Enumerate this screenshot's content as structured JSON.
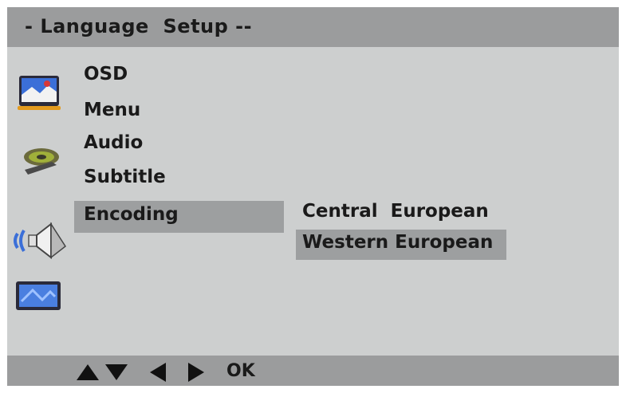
{
  "header": {
    "title": "- Language  Setup --"
  },
  "sidebar_icons": [
    {
      "name": "language-setup-icon"
    },
    {
      "name": "disc-audio-icon"
    },
    {
      "name": "speaker-icon"
    },
    {
      "name": "screen-icon"
    }
  ],
  "menu": {
    "items": [
      {
        "label": "OSD"
      },
      {
        "label": "Menu"
      },
      {
        "label": "Audio"
      },
      {
        "label": "Subtitle"
      },
      {
        "label": "Encoding"
      }
    ],
    "selected": "Encoding"
  },
  "submenu": {
    "options": [
      {
        "label": "Central  European"
      },
      {
        "label": "Western European"
      }
    ],
    "selected": "Western European"
  },
  "footer": {
    "ok_label": "OK",
    "arrows": [
      "up-arrow-icon",
      "down-arrow-icon",
      "left-arrow-icon",
      "right-arrow-icon"
    ]
  },
  "colors": {
    "background": "#cdcfcf",
    "bar": "#9b9c9d",
    "highlight": "#9d9fa0",
    "text": "#1a1a1a"
  }
}
